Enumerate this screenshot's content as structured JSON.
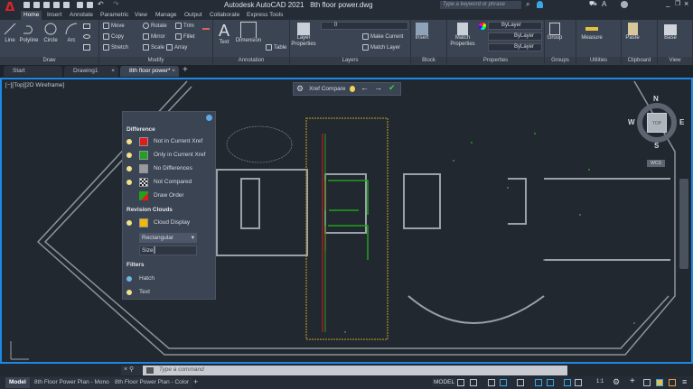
{
  "app": {
    "title": "Autodesk AutoCAD 2021",
    "file": "8th floor power.dwg",
    "logo": "A",
    "search_placeholder": "Type a keyword or phrase"
  },
  "colors": {
    "accent": "#1e88e5",
    "not_in_current": "#e01b1b",
    "only_in_current": "#22a01e",
    "no_diff": "#9a9a9a",
    "cloud": "#f5b800",
    "logo": "#d9252a"
  },
  "ribbon_tabs": [
    "Home",
    "Insert",
    "Annotate",
    "Parametric",
    "View",
    "Manage",
    "Output",
    "Collaborate",
    "Express Tools"
  ],
  "ribbon": {
    "draw": {
      "title": "Draw",
      "items": [
        "Line",
        "Polyline",
        "Circle",
        "Arc"
      ]
    },
    "modify": {
      "title": "Modify",
      "items": [
        "Move",
        "Rotate",
        "Trim",
        "Copy",
        "Mirror",
        "Fillet",
        "Stretch",
        "Scale",
        "Array"
      ]
    },
    "annotation": {
      "title": "Annotation",
      "items": [
        "Text",
        "Dimension",
        "Table"
      ]
    },
    "layers": {
      "title": "Layers",
      "layer_properties": "Layer Properties",
      "current_layer": "0",
      "make_current": "Make Current",
      "match_layer": "Match Layer"
    },
    "block": {
      "title": "Block",
      "insert": "Insert"
    },
    "properties": {
      "title": "Properties",
      "match": "Match Properties",
      "color": "ByLayer",
      "linetype": "ByLayer",
      "lineweight": "ByLayer"
    },
    "groups": {
      "title": "Groups",
      "group": "Group"
    },
    "utilities": {
      "title": "Utilities",
      "measure": "Measure"
    },
    "clipboard": {
      "title": "Clipboard",
      "paste": "Paste"
    },
    "view": {
      "title": "View",
      "base": "Base"
    }
  },
  "doc_tabs": [
    {
      "label": "Start"
    },
    {
      "label": "Drawing1"
    },
    {
      "label": "8th floor power*",
      "active": true
    }
  ],
  "viewport": {
    "label": "[−][Top][2D Wireframe]"
  },
  "xref_toolbar": {
    "label": "Xref Compare"
  },
  "viewcube": {
    "n": "N",
    "s": "S",
    "e": "E",
    "w": "W",
    "face": "TOP",
    "wcs": "WCS"
  },
  "compare_panel": {
    "difference_title": "Difference",
    "items": [
      {
        "label": "Not in Current Xref",
        "swatch": "#e01b1b"
      },
      {
        "label": "Only in Current Xref",
        "swatch": "#22a01e"
      },
      {
        "label": "No Differences",
        "swatch": "#9a9a9a"
      },
      {
        "label": "Not Compared",
        "swatch": "checker"
      },
      {
        "label": "Draw Order",
        "swatch": "draw-order"
      }
    ],
    "clouds_title": "Revision Clouds",
    "cloud_display": "Cloud Display",
    "cloud_shape": "Rectangular",
    "size_label": "Size",
    "filters_title": "Filters",
    "filters": [
      "Hatch",
      "Text"
    ]
  },
  "command": {
    "placeholder": "Type a command"
  },
  "layout_tabs": [
    "Model",
    "8th Floor Power Plan - Mono",
    "8th Floor Power Plan - Color"
  ],
  "status": {
    "model": "MODEL",
    "scale": "1:1"
  }
}
